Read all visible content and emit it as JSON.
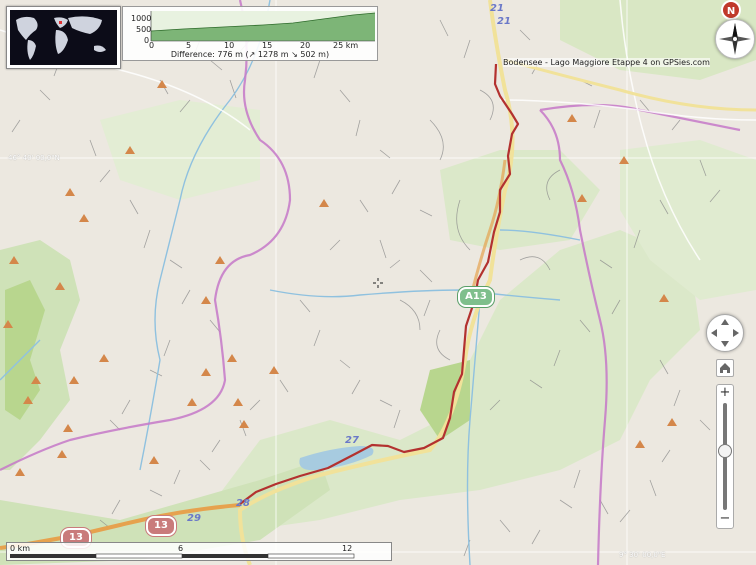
{
  "track": {
    "label": "Bodensee - Lago Maggiore  Etappe 4 on GPSies.com",
    "color": "#b3312f"
  },
  "profile": {
    "y_ticks": [
      "1000",
      "500",
      "0"
    ],
    "x_ticks": [
      "0",
      "5",
      "10",
      "15",
      "20",
      "25 km"
    ],
    "difference": "Difference: 776 m  (↗ 1278 m  ↘ 502 m)"
  },
  "scale": {
    "labels": [
      "0 km",
      "6",
      "12"
    ]
  },
  "coordinates": {
    "lat_label": "46° 40' 00,0\"N",
    "lon_label": "9° 30' 00,0\"E"
  },
  "roads": {
    "numbers": [
      "21",
      "21",
      "27",
      "28",
      "29"
    ],
    "shields": [
      "13",
      "13",
      "A13"
    ]
  },
  "controls": {
    "zoom_in": "+",
    "zoom_out": "−",
    "info": "N"
  },
  "colors": {
    "land": "#ece8e0",
    "forest": "#cfe2b8",
    "meadow": "#b8d68e",
    "water": "#a7cbe0",
    "river": "#8fc1df",
    "border": "#c678c8",
    "road_major": "#f1e29a",
    "road_motorway": "#e6a24e"
  }
}
